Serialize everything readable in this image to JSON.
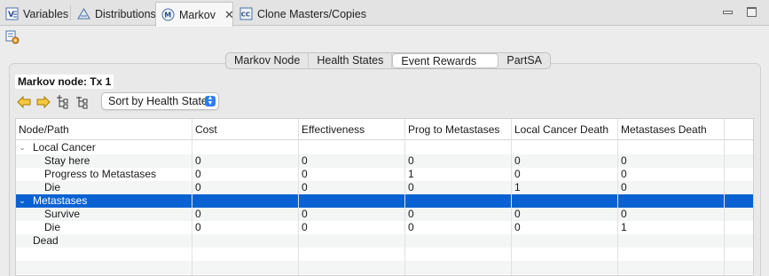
{
  "tabs": [
    {
      "label": "Variables",
      "icon": "variables-icon"
    },
    {
      "label": "Distributions",
      "icon": "distributions-icon"
    },
    {
      "label": "Markov",
      "icon": "markov-icon",
      "active": true
    },
    {
      "label": "Clone Masters/Copies",
      "icon": "clone-icon"
    }
  ],
  "segments": [
    "Markov Node",
    "Health States",
    "Event Rewards",
    "PartSA"
  ],
  "selected_segment": "Event Rewards",
  "node_label": "Markov node: Tx 1",
  "sort": {
    "value": "Sort by Health State"
  },
  "columns": [
    "Node/Path",
    "Cost",
    "Effectiveness",
    "Prog to Metastases",
    "Local Cancer Death",
    "Metastases Death"
  ],
  "rows": [
    {
      "label": "Local Cancer",
      "level": 0,
      "expanded": true,
      "values": [
        "",
        "",
        "",
        "",
        ""
      ]
    },
    {
      "label": "Stay here",
      "level": 1,
      "values": [
        "0",
        "0",
        "0",
        "0",
        "0"
      ]
    },
    {
      "label": "Progress to  Metastases",
      "level": 1,
      "values": [
        "0",
        "0",
        "1",
        "0",
        "0"
      ]
    },
    {
      "label": "Die",
      "level": 1,
      "values": [
        "0",
        "0",
        "0",
        "1",
        "0"
      ]
    },
    {
      "label": "Metastases",
      "level": 0,
      "expanded": true,
      "selected": true,
      "values": [
        "",
        "",
        "",
        "",
        ""
      ]
    },
    {
      "label": "Survive",
      "level": 1,
      "values": [
        "0",
        "0",
        "0",
        "0",
        "0"
      ]
    },
    {
      "label": "Die",
      "level": 1,
      "values": [
        "0",
        "0",
        "0",
        "0",
        "1"
      ]
    },
    {
      "label": "Dead",
      "level": 0,
      "values": [
        "",
        "",
        "",
        "",
        ""
      ]
    }
  ],
  "colors": {
    "selection": "#0a62d2",
    "accent": "#2d7cf6"
  }
}
